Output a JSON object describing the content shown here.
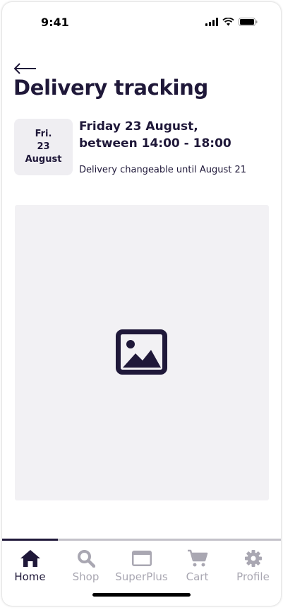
{
  "status_bar": {
    "time": "9:41"
  },
  "header": {
    "title": "Delivery tracking"
  },
  "delivery": {
    "date_badge": {
      "day": "Fri.",
      "date": "23",
      "month": "August"
    },
    "window_line1": "Friday 23 August,",
    "window_line2": "between 14:00 - 18:00",
    "note": "Delivery changeable until August 21"
  },
  "nav": {
    "items": [
      {
        "label": "Home",
        "icon": "home-icon",
        "active": true
      },
      {
        "label": "Shop",
        "icon": "search-icon",
        "active": false
      },
      {
        "label": "SuperPlus",
        "icon": "card-icon",
        "active": false
      },
      {
        "label": "Cart",
        "icon": "cart-icon",
        "active": false
      },
      {
        "label": "Profile",
        "icon": "gear-icon",
        "active": false
      }
    ]
  },
  "colors": {
    "primary": "#1f1839",
    "muted": "#a9a7b2",
    "surface": "#f2f1f4"
  }
}
